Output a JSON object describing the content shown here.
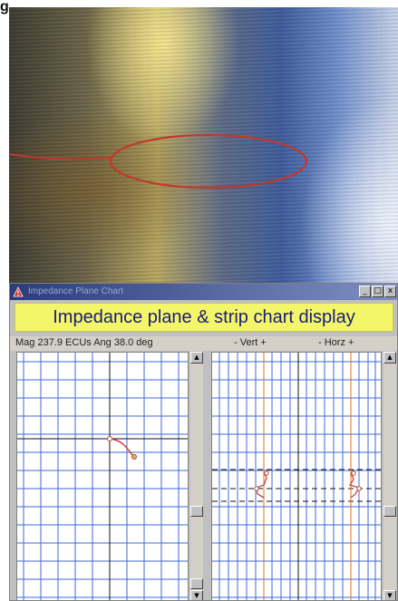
{
  "figure": {
    "panel_letter": "g"
  },
  "window": {
    "title": "Impedance Plane Chart",
    "buttons": {
      "minimize": "_",
      "maximize": "□",
      "close": "x"
    }
  },
  "banner": {
    "text": "Impedance plane & strip chart display"
  },
  "readout": {
    "text": "Mag 237.9 ECUs Ang 38.0 deg",
    "vert_label": "- Vert +",
    "horz_label": "- Horz +"
  },
  "icons": {
    "app": "warning-triangle-icon",
    "scroll_up": "arrow-up-icon",
    "scroll_down": "arrow-down-icon"
  },
  "colors": {
    "annotation_red": "#c0392b",
    "grid_blue": "#3f6ad8",
    "trace_red": "#d04040",
    "strip_orange": "#e07020",
    "banner_yellow": "#f4f66a",
    "banner_text": "#1a1a7a"
  }
}
